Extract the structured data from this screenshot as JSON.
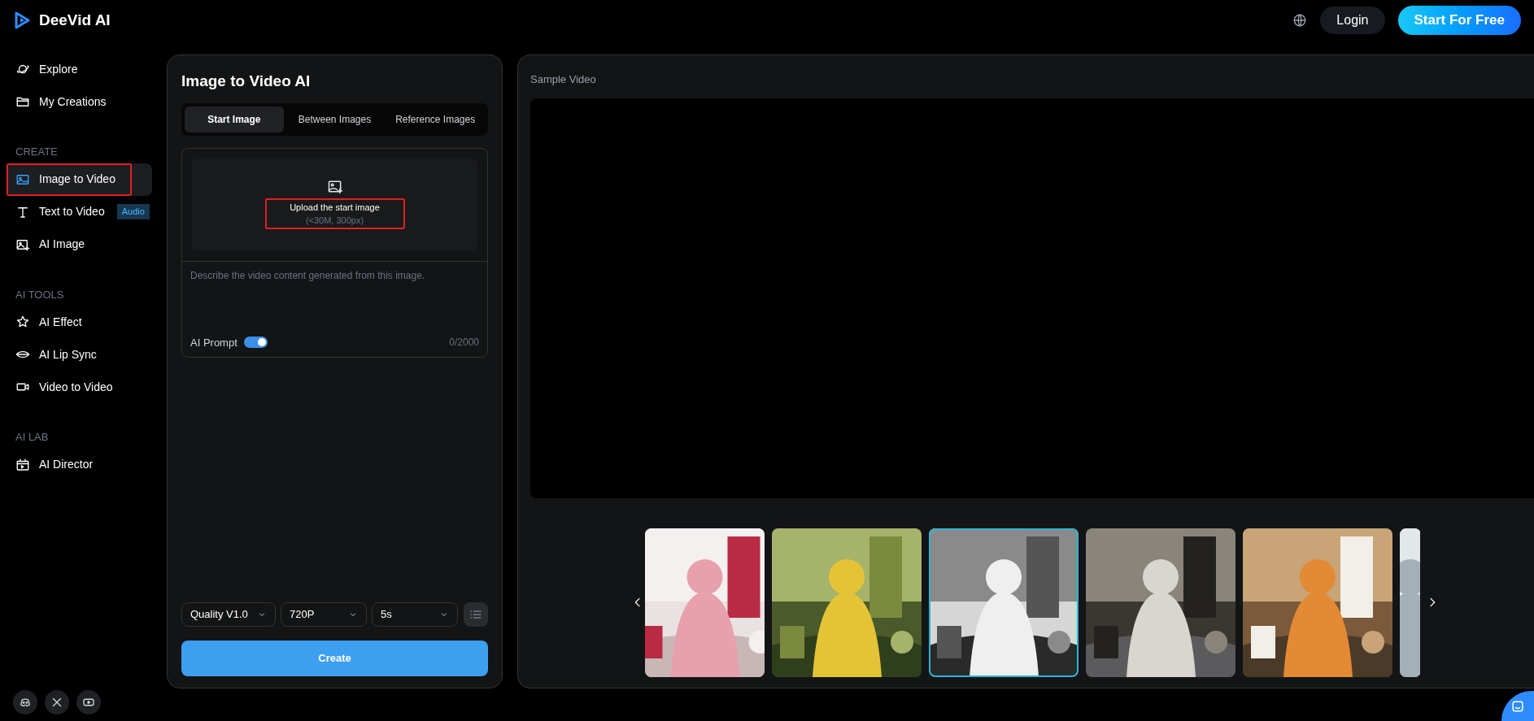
{
  "header": {
    "logo": "DeeVid AI",
    "login": "Login",
    "cta": "Start For Free"
  },
  "sidebar": {
    "sections": [
      {
        "items": [
          {
            "label": "Explore",
            "selected": false,
            "annotated": false
          },
          {
            "label": "My Creations",
            "selected": false,
            "annotated": false
          }
        ]
      },
      {
        "heading": "CREATE",
        "items": [
          {
            "label": "Image to Video",
            "selected": true,
            "annotated": true
          },
          {
            "label": "Text to Video",
            "badge": "Audio",
            "selected": false,
            "annotated": false
          },
          {
            "label": "AI Image",
            "selected": false,
            "annotated": false
          }
        ]
      },
      {
        "heading": "AI TOOLS",
        "items": [
          {
            "label": "AI Effect",
            "selected": false,
            "annotated": false
          },
          {
            "label": "AI Lip Sync",
            "selected": false,
            "annotated": false
          },
          {
            "label": "Video to Video",
            "selected": false,
            "annotated": false
          }
        ]
      },
      {
        "heading": "AI LAB",
        "items": [
          {
            "label": "AI Director",
            "selected": false,
            "annotated": false
          }
        ]
      }
    ]
  },
  "panel": {
    "title": "Image to Video AI",
    "tabs": [
      {
        "label": "Start Image",
        "selected": true
      },
      {
        "label": "Between Images",
        "selected": false
      },
      {
        "label": "Reference Images",
        "selected": false
      }
    ],
    "upload": {
      "title": "Upload the start image",
      "hint": "(<30M, 300px)",
      "annotated": true
    },
    "prompt": {
      "placeholder": "Describe the video content generated from this image.",
      "ai_prompt_label": "AI Prompt",
      "ai_prompt_on": true,
      "counter": "0/2000"
    },
    "selects": [
      "Quality V1.0",
      "720P",
      "5s"
    ],
    "create_button": "Create"
  },
  "preview": {
    "label": "Sample Video",
    "thumbnails": [
      {
        "kind": "picture",
        "selected": false
      },
      {
        "kind": "picture",
        "selected": false
      },
      {
        "kind": "picture",
        "selected": true
      },
      {
        "kind": "picture",
        "selected": false
      },
      {
        "kind": "picture",
        "selected": false
      },
      {
        "kind": "picture",
        "selected": false
      }
    ]
  }
}
